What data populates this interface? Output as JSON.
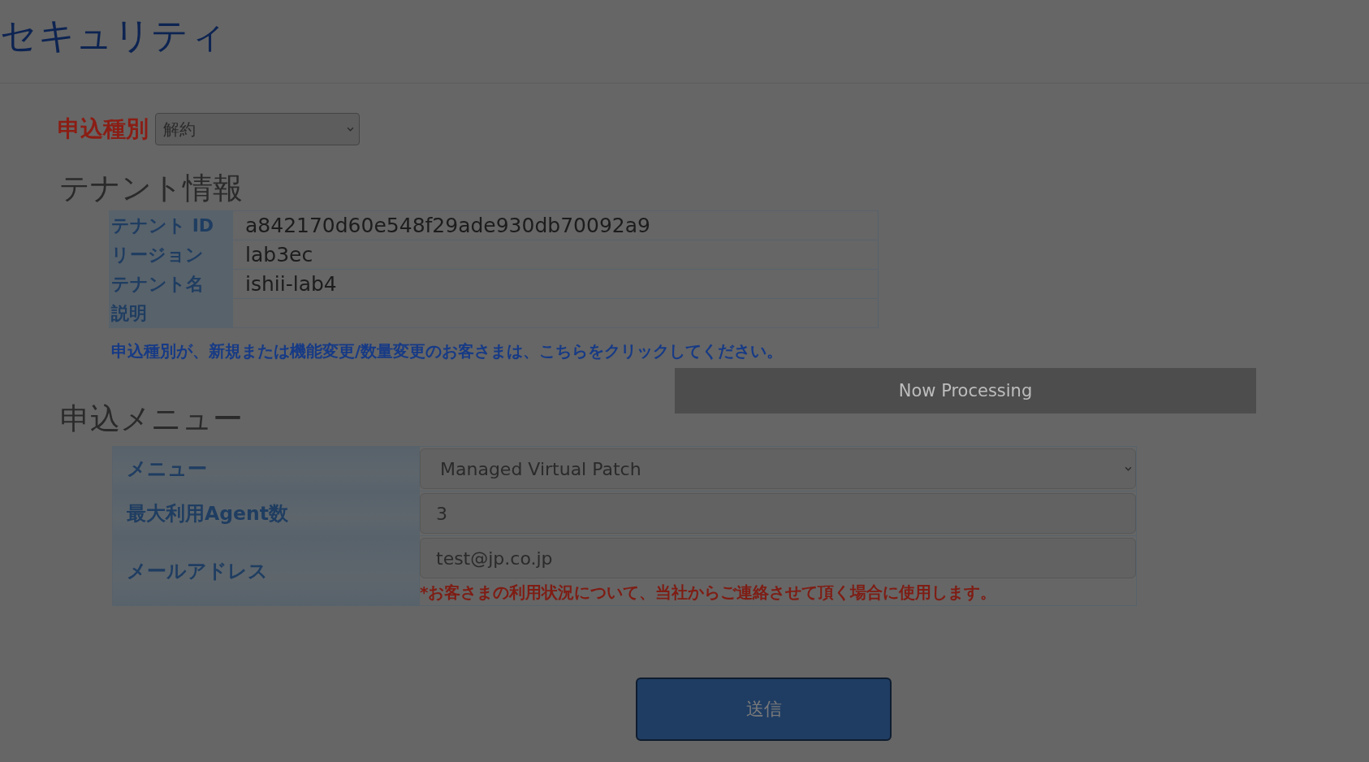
{
  "page": {
    "title": "セキュリティ"
  },
  "application_type": {
    "label": "申込種別",
    "value": "解約"
  },
  "tenant_info": {
    "heading": "テナント情報",
    "rows": [
      {
        "label": "テナント ID",
        "value": "a842170d60e548f29ade930db70092a9"
      },
      {
        "label": "リージョン",
        "value": "lab3ec"
      },
      {
        "label": "テナント名",
        "value": "ishii-lab4"
      },
      {
        "label": "説明"
      }
    ],
    "link": "申込種別が、新規または機能変更/数量変更のお客さまは、こちらをクリックしてください。"
  },
  "processing_overlay": {
    "message": "Now Processing"
  },
  "application_menu": {
    "heading": "申込メニュー",
    "rows": [
      {
        "kind": "select",
        "label": "メニュー",
        "value": "Managed Virtual Patch"
      },
      {
        "kind": "input",
        "label": "最大利用Agent数",
        "value": "3"
      },
      {
        "kind": "input",
        "label": "メールアドレス",
        "value": "test@jp.co.jp",
        "note": "*お客さまの利用状況について、当社からご連絡させて頂く場合に使用します。"
      }
    ]
  },
  "submit_button": {
    "label": "送信"
  }
}
